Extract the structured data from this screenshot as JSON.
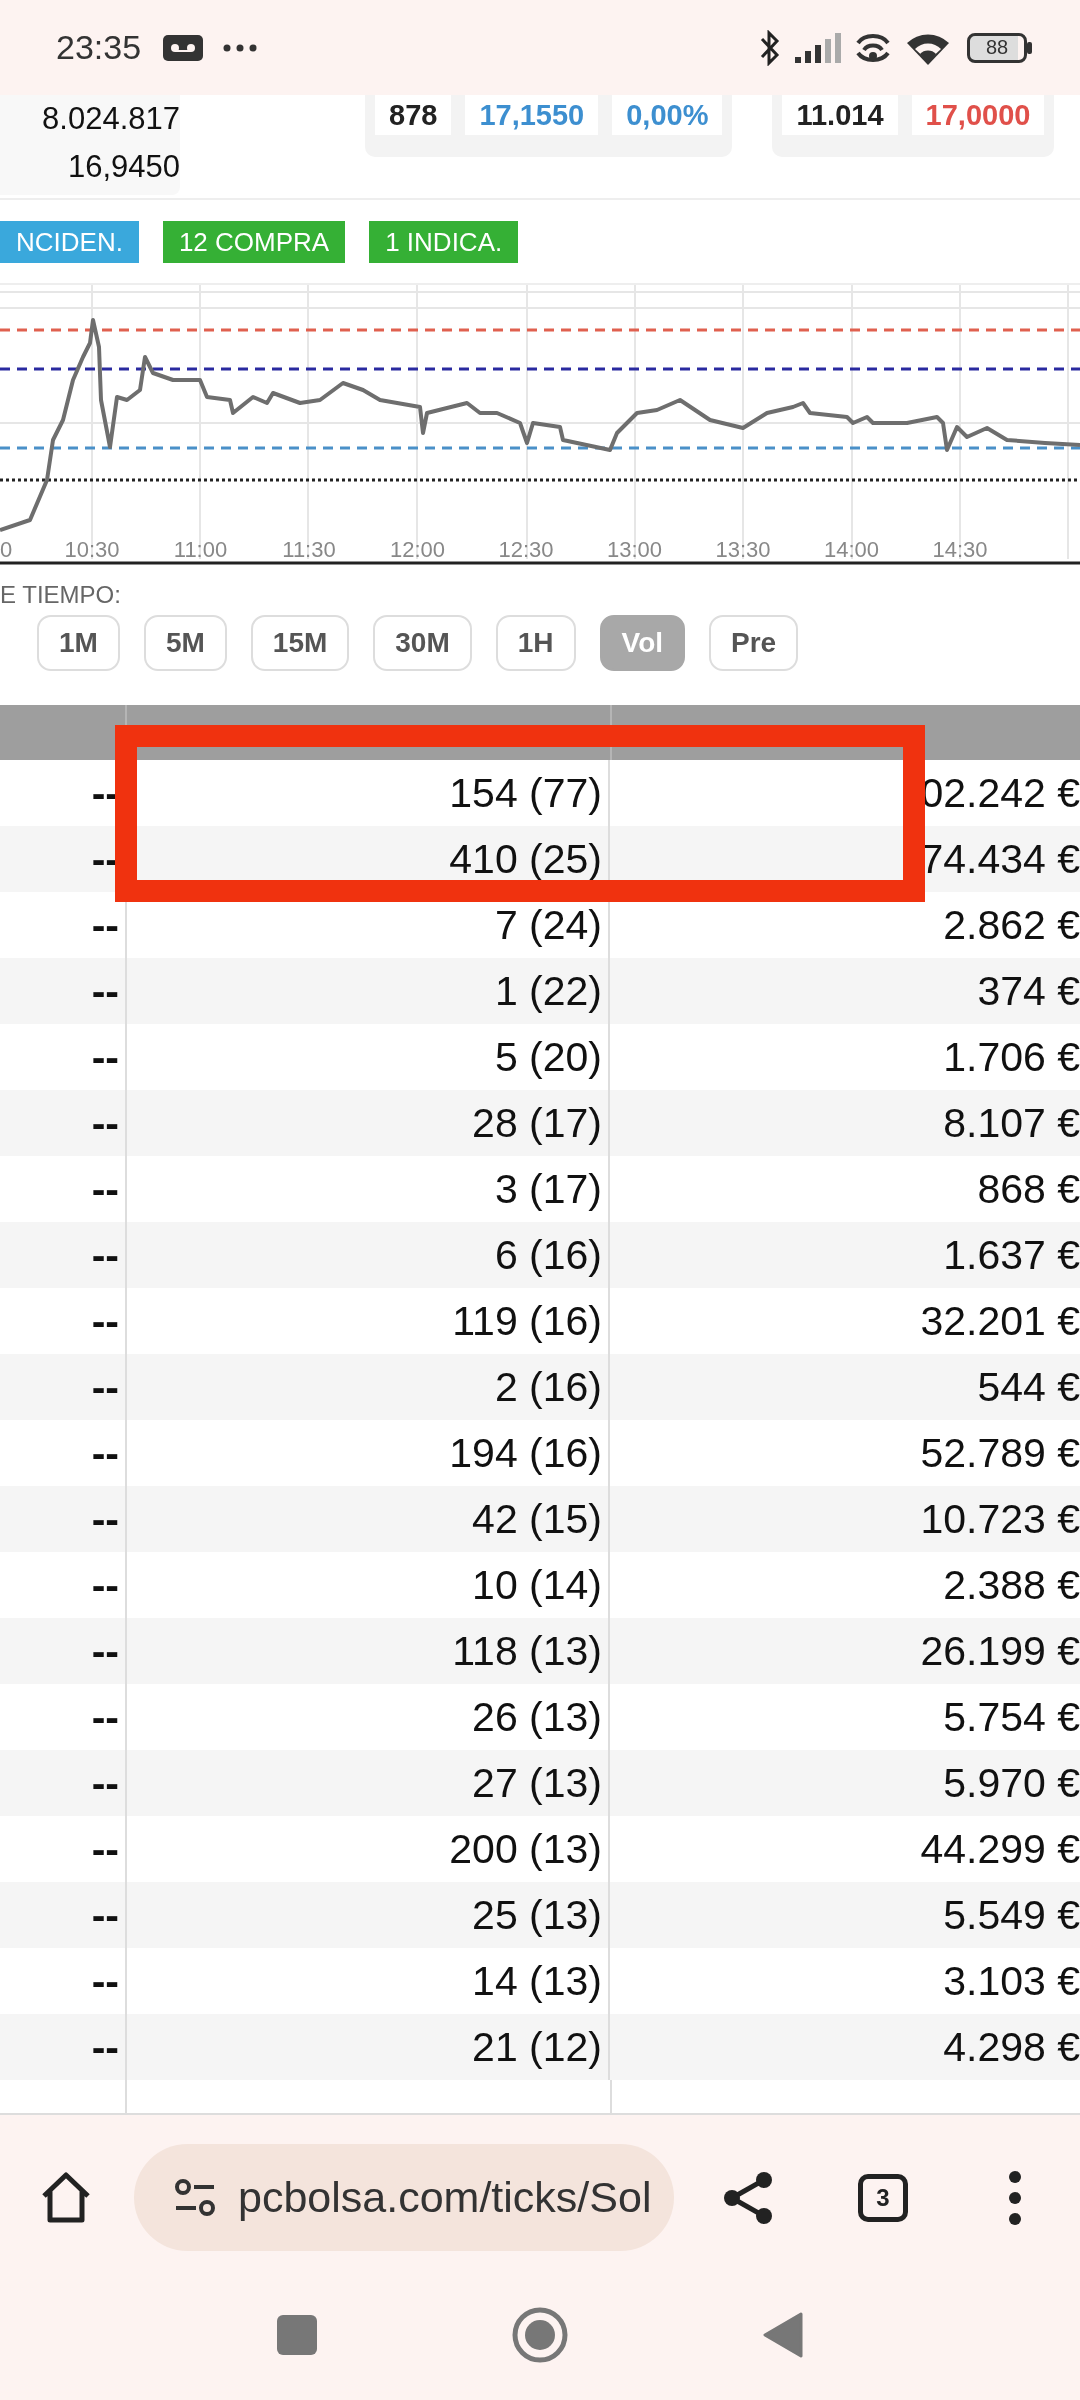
{
  "status_bar": {
    "time": "23:35",
    "battery": "88"
  },
  "summary": {
    "values": [
      "8.024.817",
      "16,9450"
    ]
  },
  "quote_cards": [
    {
      "cells": [
        {
          "text": "878",
          "color": "#222222"
        },
        {
          "text": "17,1550",
          "color": "#3d8fd0"
        },
        {
          "text": "0,00%",
          "color": "#3d8fd0"
        }
      ]
    },
    {
      "cells": [
        {
          "text": "11.014",
          "color": "#222222"
        },
        {
          "text": "17,0000",
          "color": "#e0504a"
        }
      ]
    }
  ],
  "badges": [
    {
      "label": "NCIDEN.",
      "color": "#3aa8dc"
    },
    {
      "label": "12 COMPRA",
      "color": "#35b035"
    },
    {
      "label": "1 INDICA.",
      "color": "#35b035"
    }
  ],
  "chart": {
    "time_labels": [
      "0",
      "10:30",
      "11:00",
      "11:30",
      "12:00",
      "12:30",
      "13:00",
      "13:30",
      "14:00",
      "14:30"
    ],
    "reference_lines": [
      {
        "color": "#e0604f",
        "kind": "dashed"
      },
      {
        "color": "#2a2aa0",
        "kind": "dashed"
      },
      {
        "color": "#4a90c8",
        "kind": "dashed"
      },
      {
        "color": "#222222",
        "kind": "dotted"
      }
    ]
  },
  "interval_label": "E TIEMPO:",
  "interval_buttons": [
    {
      "label": "1M",
      "selected": false
    },
    {
      "label": "5M",
      "selected": false
    },
    {
      "label": "15M",
      "selected": false
    },
    {
      "label": "30M",
      "selected": false
    },
    {
      "label": "1H",
      "selected": false
    },
    {
      "label": "Vol",
      "selected": true
    },
    {
      "label": "Pre",
      "selected": false
    }
  ],
  "table": {
    "rows": [
      {
        "column_1": "--",
        "column_2": "154 (77)",
        "column_3": "02.242 €"
      },
      {
        "column_1": "--",
        "column_2": "410 (25)",
        "column_3": "74.434 €"
      },
      {
        "column_1": "--",
        "column_2": "7 (24)",
        "column_3": "2.862 €"
      },
      {
        "column_1": "--",
        "column_2": "1 (22)",
        "column_3": "374 €"
      },
      {
        "column_1": "--",
        "column_2": "5 (20)",
        "column_3": "1.706 €"
      },
      {
        "column_1": "--",
        "column_2": "28 (17)",
        "column_3": "8.107 €"
      },
      {
        "column_1": "--",
        "column_2": "3 (17)",
        "column_3": "868 €"
      },
      {
        "column_1": "--",
        "column_2": "6 (16)",
        "column_3": "1.637 €"
      },
      {
        "column_1": "--",
        "column_2": "119 (16)",
        "column_3": "32.201 €"
      },
      {
        "column_1": "--",
        "column_2": "2 (16)",
        "column_3": "544 €"
      },
      {
        "column_1": "--",
        "column_2": "194 (16)",
        "column_3": "52.789 €"
      },
      {
        "column_1": "--",
        "column_2": "42 (15)",
        "column_3": "10.723 €"
      },
      {
        "column_1": "--",
        "column_2": "10 (14)",
        "column_3": "2.388 €"
      },
      {
        "column_1": "--",
        "column_2": "118 (13)",
        "column_3": "26.199 €"
      },
      {
        "column_1": "--",
        "column_2": "26 (13)",
        "column_3": "5.754 €"
      },
      {
        "column_1": "--",
        "column_2": "27 (13)",
        "column_3": "5.970 €"
      },
      {
        "column_1": "--",
        "column_2": "200 (13)",
        "column_3": "44.299 €"
      },
      {
        "column_1": "--",
        "column_2": "25 (13)",
        "column_3": "5.549 €"
      },
      {
        "column_1": "--",
        "column_2": "14 (13)",
        "column_3": "3.103 €"
      },
      {
        "column_1": "--",
        "column_2": "21 (12)",
        "column_3": "4.298 €"
      }
    ]
  },
  "browser": {
    "url": "pcbolsa.com/ticks/Sol",
    "tab_count": "3"
  }
}
